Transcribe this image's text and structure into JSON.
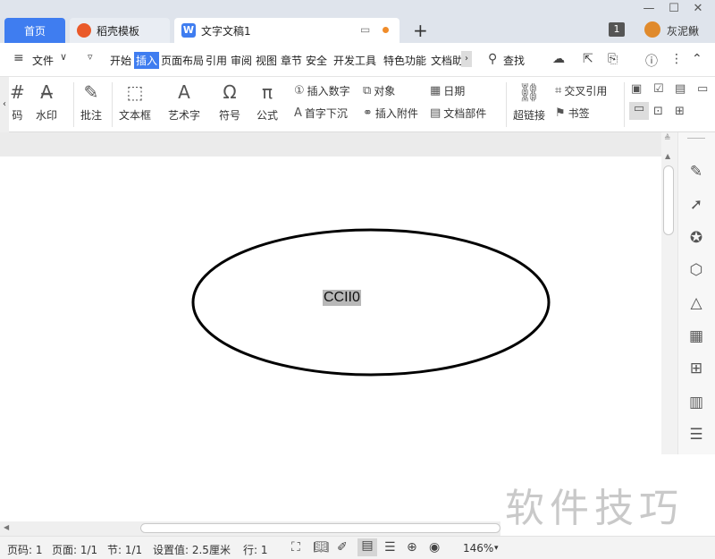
{
  "tabs": {
    "home": "首页",
    "daoke": "稻壳模板",
    "doc": "文字文稿1",
    "new_tab": "+"
  },
  "titlebar": {
    "notif_count": "1",
    "user_name": "灰泥鳅"
  },
  "menu": {
    "file": "文件",
    "items": [
      "开始",
      "插入",
      "页面布局",
      "引用",
      "审阅",
      "视图",
      "章节",
      "安全",
      "开发工具",
      "特色功能",
      "文档助"
    ],
    "active": "插入",
    "search": "查找"
  },
  "ribbon": {
    "cut_left": "码",
    "watermark": "水印",
    "comment": "批注",
    "textbox": "文本框",
    "wordart": "艺术字",
    "symbol": "符号",
    "formula": "公式",
    "insert_number": "插入数字",
    "object": "对象",
    "date": "日期",
    "drop_cap": "首字下沉",
    "insert_attachment": "插入附件",
    "doc_parts": "文档部件",
    "hyperlink": "超链接",
    "cross_ref": "交叉引用",
    "bookmark": "书签"
  },
  "document": {
    "shape_text": "CCII0"
  },
  "status": {
    "page_no": "页码: 1",
    "pages": "页面: 1/1",
    "section": "节: 1/1",
    "setting": "设置值: 2.5厘米",
    "row": "行: 1",
    "zoom": "146%"
  },
  "watermark_text": "软件技巧",
  "colors": {
    "accent": "#3f7df0",
    "titlebar_bg": "#dfe4ec",
    "shape_stroke": "#000000",
    "text_highlight": "#b8b8b8"
  }
}
